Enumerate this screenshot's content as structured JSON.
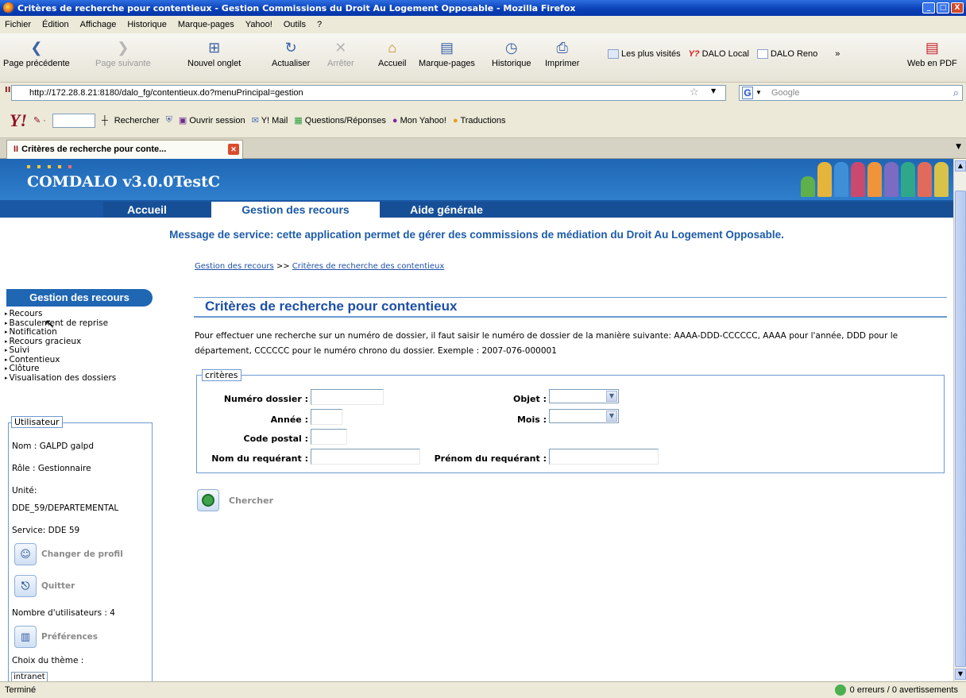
{
  "window": {
    "title": "Critères de recherche pour contentieux - Gestion Commissions du Droit Au Logement Opposable - Mozilla Firefox",
    "controls": [
      "_",
      "□",
      "X"
    ]
  },
  "menubar": [
    "Fichier",
    "Édition",
    "Affichage",
    "Historique",
    "Marque-pages",
    "Yahoo!",
    "Outils",
    "?"
  ],
  "toolbar": {
    "back": "Page précédente",
    "forward": "Page suivante",
    "new_tab": "Nouvel onglet",
    "reload": "Actualiser",
    "stop": "Arrêter",
    "home": "Accueil",
    "bookmarks": "Marque-pages",
    "history": "Historique",
    "print": "Imprimer",
    "bm1": "Les plus visités",
    "bm2": "DALO Local",
    "bm3": "DALO Reno",
    "more": "»",
    "pdf": "Web en PDF"
  },
  "urlbar": {
    "url": "http://172.28.8.21:8180/dalo_fg/contentieux.do?menuPrincipal=gestion",
    "search_placeholder": "Google"
  },
  "yahoo_toolbar": {
    "search": "Rechercher",
    "session": "Ouvrir session",
    "mail": "Y! Mail",
    "qa": "Questions/Réponses",
    "my_yahoo": "Mon Yahoo!",
    "translate": "Traductions"
  },
  "tab": {
    "label": "Critères de recherche pour conte..."
  },
  "app": {
    "title": "COMDALO v3.0.0TestC",
    "nav": [
      "Accueil",
      "Gestion des recours",
      "Aide générale"
    ],
    "service_message": "Message de service: cette application permet de gérer des commissions de médiation du Droit Au Logement Opposable.",
    "breadcrumb_1": "Gestion des recours",
    "breadcrumb_sep": ">>",
    "breadcrumb_2": "Critères de recherche des contentieux"
  },
  "sidebar": {
    "title": "Gestion des recours",
    "items": [
      "Recours",
      "Basculement de reprise",
      "Notification",
      "Recours gracieux",
      "Suivi",
      "Contentieux",
      "Clôture",
      "Visualisation des dossiers"
    ],
    "user_legend": "Utilisateur",
    "nom": "Nom : GALPD galpd",
    "role": "Rôle : Gestionnaire",
    "unite_label": "Unité:",
    "unite_value": "DDE_59/DEPARTEMENTAL",
    "service": "Service: DDE 59",
    "change_profile": "Changer de profil",
    "quit": "Quitter",
    "user_count": "Nombre d'utilisateurs : 4",
    "preferences": "Préférences",
    "theme_label": "Choix du thème :",
    "theme_value": "intranet"
  },
  "main": {
    "title": "Critères de recherche pour contentieux",
    "intro": "Pour effectuer une recherche sur un numéro de dossier, il faut saisir le numéro de dossier de la manière suivante: AAAA-DDD-CCCCCC, AAAA pour l'année, DDD pour le département, CCCCCC pour le numéro chrono du dossier. Exemple : 2007-076-000001",
    "criteria_legend": "critères",
    "labels": {
      "numero": "Numéro dossier :",
      "annee": "Année :",
      "code_postal": "Code postal :",
      "nom": "Nom du requérant :",
      "objet": "Objet :",
      "mois": "Mois :",
      "prenom": "Prénom du requérant :"
    },
    "search_button": "Chercher"
  },
  "status": {
    "left": "Terminé",
    "right": "0 erreurs / 0 avertissements"
  }
}
